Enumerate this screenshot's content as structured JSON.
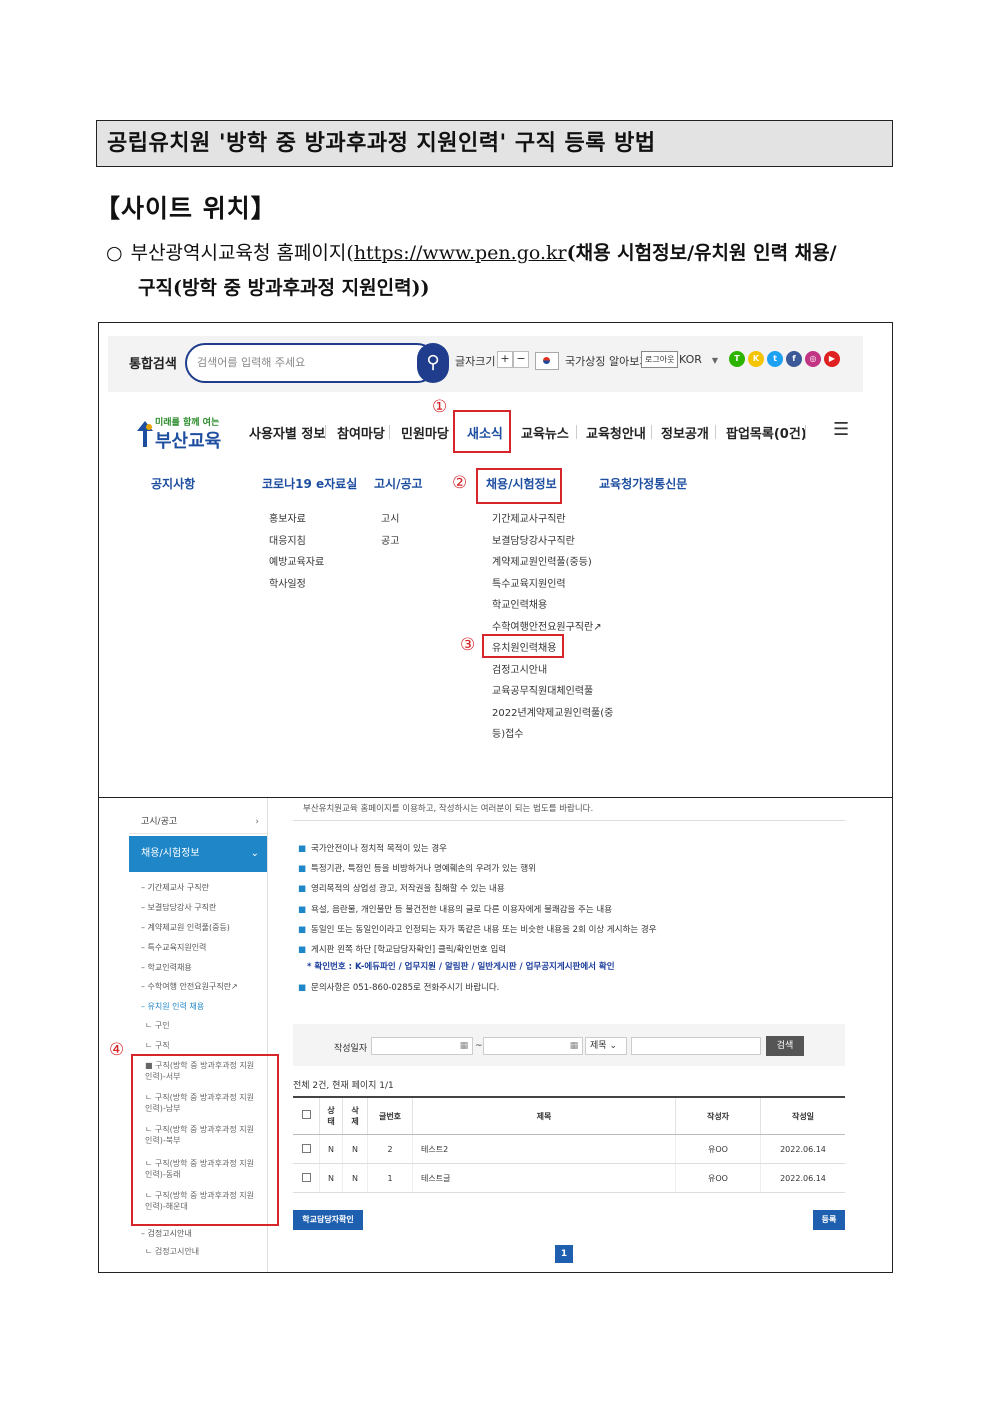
{
  "doc": {
    "title": "공립유치원 '방학 중 방과후과정 지원인력' 구직 등록 방법",
    "site_heading": "【사이트 위치】",
    "bullet_circle": "○",
    "bullet_prefix": "부산광역시교육청 홈페이지(",
    "bullet_url": "https://www.pen.go.kr",
    "bullet_suffix": "(채용 시험정보/유치원 인력 채용/",
    "bullet_line2": "구직(방학 중 방과후과정 지원인력))"
  },
  "shot1": {
    "search_label": "통합검색",
    "search_placeholder": "검색어를 입력해 주세요",
    "font_size_label": "글자크기",
    "font_plus": "+",
    "font_minus": "−",
    "symbol_text": "국가상징 알아보기",
    "logout": "로그아웃",
    "lang": "KOR",
    "logo_small": "미래를 함께 여는",
    "logo_big": "부산교육",
    "nav": [
      "사용자별 정보",
      "참여마당",
      "민원마당",
      "새소식",
      "교육뉴스",
      "교육청안내",
      "정보공개",
      "팝업목록(0건)"
    ],
    "columns": {
      "c1": {
        "head": "공지사항"
      },
      "c2": {
        "head": "코로나19 e자료실",
        "items": [
          "홍보자료",
          "대응지침",
          "예방교육자료",
          "학사일정"
        ]
      },
      "c3": {
        "head": "고시/공고",
        "items": [
          "고시",
          "공고"
        ]
      },
      "c4": {
        "head": "채용/시험정보",
        "items": [
          "기간제교사구직란",
          "보결담당강사구직란",
          "계약제교원인력풀(중등)",
          "특수교육지원인력",
          "학교인력채용",
          "수학여행안전요원구직란",
          "유치원인력채용",
          "검정고시안내",
          "교육공무직원대체인력풀",
          "2022년계약제교원인력풀(중",
          "등)접수"
        ]
      },
      "c5": {
        "head": "교육청가정통신문"
      }
    },
    "steps": [
      "①",
      "②",
      "③"
    ]
  },
  "shot2": {
    "cut_text": "부산유치원교육 홈페이지를 이용하고, 작성하시는 여러분이 되는 법도를 바랍니다.",
    "left_nav": {
      "top_item": "고시/공고",
      "active": "채용/시험정보",
      "subs": [
        "– 기간제교사 구직란",
        "– 보결담당강사 구직란",
        "– 계약제교원 인력풀(중등)",
        "– 특수교육지원인력",
        "– 학교인력채용",
        "– 수학여행 안전요원구직란",
        "– 유치원 인력 채용"
      ],
      "deep": [
        "ㄴ 구인",
        "ㄴ 구직",
        "■ 구직(방학 중 방과후과정 지원인력)-서부",
        "ㄴ 구직(방학 중 방과후과정 지원인력)-남부",
        "ㄴ 구직(방학 중 방과후과정 지원인력)-북부",
        "ㄴ 구직(방학 중 방과후과정 지원인력)-동래",
        "ㄴ 구직(방학 중 방과후과정 지원인력)-해운대"
      ],
      "bottom_sub": "– 검정고시안내",
      "bottom_deep": "ㄴ 검정고시안내"
    },
    "step": "④",
    "notices": [
      "국가안전이나 정치적 목적이 있는 경우",
      "특정기관, 특정인 등을 비방하거나 명예훼손의 우려가 있는 행위",
      "영리목적의 상업성 광고, 저작권을 침해할 수 있는 내용",
      "욕설, 음란물, 개인불만 등 불건전한 내용의 글로 다른 이용자에게 불쾌감을 주는 내용",
      "동일인 또는 동일인이라고 인정되는 자가 똑같은 내용 또는 비슷한 내용을 2회 이상 게시하는 경우",
      "게시판 왼쪽 하단 [학교담당자확인] 클릭/확인번호 입력"
    ],
    "notice_highlight": "* 확인번호 : K-에듀파인 / 업무지원 / 알림판 / 일반게시판 / 업무공지게시판에서 확인",
    "notice_contact": "문의사항은 051-860-0285로 전화주시기 바랍니다.",
    "filter_label": "작성일자",
    "tilde": "~",
    "select_value": "제목",
    "search_button": "검색",
    "count_text": "전체 2건, 현재 페이지 1/1",
    "table": {
      "headers": [
        "",
        "상태",
        "삭제",
        "글번호",
        "제목",
        "작성자",
        "작성일"
      ],
      "rows": [
        [
          "",
          "N",
          "N",
          "2",
          "테스트2",
          "유OO",
          "2022.06.14"
        ],
        [
          "",
          "N",
          "N",
          "1",
          "테스트글",
          "유OO",
          "2022.06.14"
        ]
      ]
    },
    "confirm_button": "학교담당자확인",
    "register_button": "등록",
    "page": "1"
  }
}
